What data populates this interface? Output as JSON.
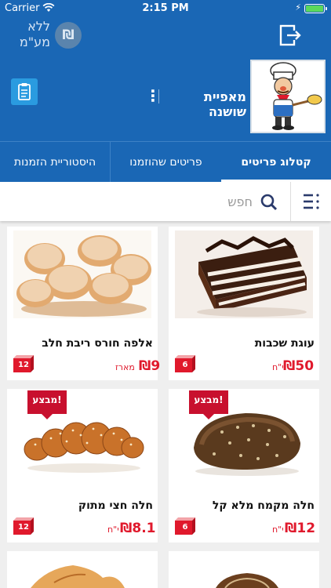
{
  "status_bar": {
    "carrier": "Carrier",
    "time": "2:15 PM"
  },
  "top_bar": {
    "no_vat_line1": "ללא",
    "no_vat_line2": "מע\"מ",
    "currency_symbol": "₪"
  },
  "store": {
    "name": "מאפיית שושנה"
  },
  "tabs": [
    {
      "label": "קטלוג פריטים",
      "active": true
    },
    {
      "label": "פריטים שהוזמנו",
      "active": false
    },
    {
      "label": "היסטוריית הזמנות",
      "active": false
    }
  ],
  "search": {
    "placeholder": "חפש",
    "value": ""
  },
  "products": [
    {
      "name": "עוגת שכבות",
      "price": "₪50",
      "unit": "י\"ח",
      "cart_count": "6",
      "sale": false
    },
    {
      "name": "אלפה חורס ריבת חלב",
      "price": "₪9",
      "unit": "מארז",
      "cart_count": "12",
      "sale": false
    },
    {
      "name": "חלה מקמח מלא קל",
      "price": "₪12",
      "unit": "י\"ח",
      "cart_count": "6",
      "sale": true,
      "sale_label": "מבצע!"
    },
    {
      "name": "חלה חצי  מתוק",
      "price": "₪8.1",
      "unit": "י\"ח",
      "cart_count": "12",
      "sale": true,
      "sale_label": "מבצע!"
    }
  ],
  "colors": {
    "brand_blue": "#1a67b5",
    "accent_red": "#e0192c",
    "sale_red": "#c8102e",
    "button_blue": "#2a9be0"
  }
}
